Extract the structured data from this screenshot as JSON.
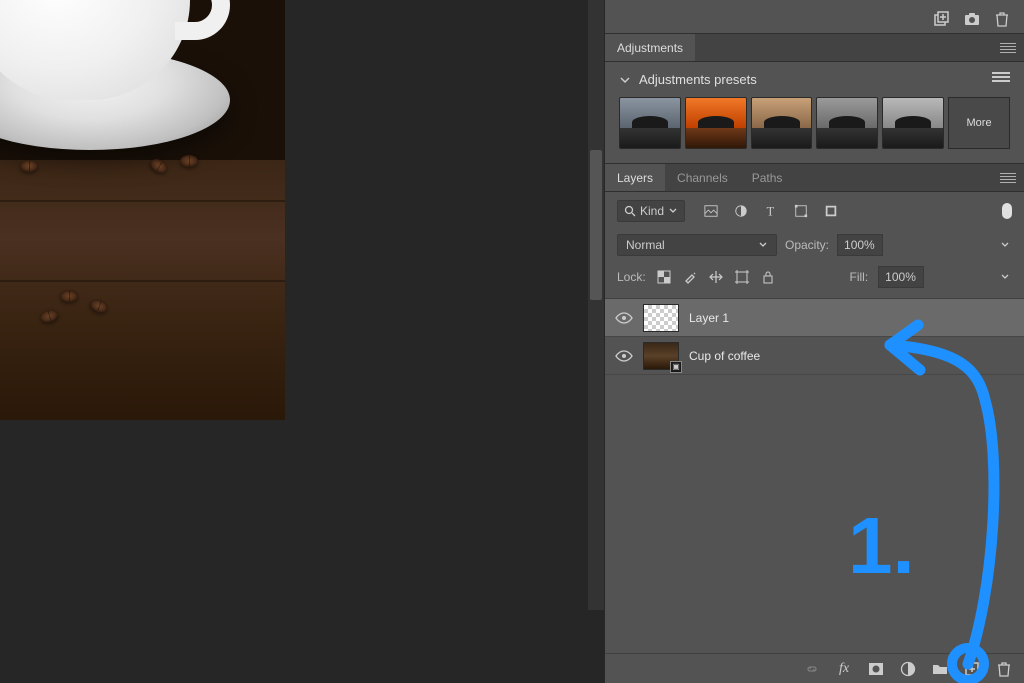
{
  "panels": {
    "adjustments": {
      "tab_label": "Adjustments",
      "presets_label": "Adjustments presets",
      "more_label": "More"
    },
    "layers": {
      "tabs": [
        "Layers",
        "Channels",
        "Paths"
      ],
      "active_tab": 0,
      "kind_label": "Kind",
      "blend_mode": "Normal",
      "opacity_label": "Opacity:",
      "opacity_value": "100%",
      "lock_label": "Lock:",
      "fill_label": "Fill:",
      "fill_value": "100%",
      "items": [
        {
          "name": "Layer 1",
          "thumb": "transparent",
          "selected": true
        },
        {
          "name": "Cup of coffee",
          "thumb": "coffee",
          "selected": false,
          "smart": true
        }
      ]
    }
  },
  "filter_search_icon": "search-icon",
  "annotation": {
    "number": "1."
  },
  "presets": [
    {
      "sky": "#6b7a88"
    },
    {
      "sky": "#e05a1a"
    },
    {
      "sky": "#b08860"
    },
    {
      "sky": "#7a7a7a"
    },
    {
      "sky": "#9a9a9a"
    }
  ]
}
